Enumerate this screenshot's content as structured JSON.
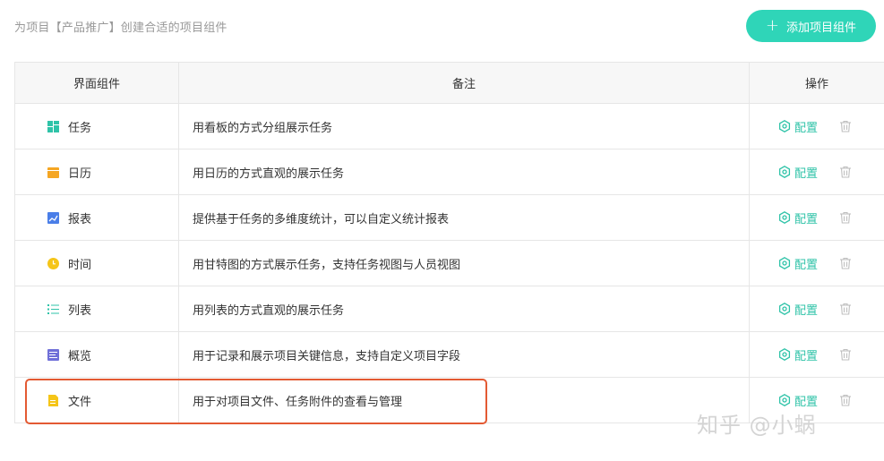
{
  "header": {
    "subtitle": "为项目【产品推广】创建合适的项目组件",
    "add_button_label": "添加项目组件",
    "accent_color": "#2fd5b8"
  },
  "table": {
    "columns": [
      "界面组件",
      "备注",
      "操作"
    ],
    "config_label": "配置",
    "rows": [
      {
        "name": "任务",
        "icon": "kanban-icon",
        "icon_color": "#2fc3a8",
        "note": "用看板的方式分组展示任务"
      },
      {
        "name": "日历",
        "icon": "calendar-icon",
        "icon_color": "#f5a623",
        "note": "用日历的方式直观的展示任务"
      },
      {
        "name": "报表",
        "icon": "chart-icon",
        "icon_color": "#4a7ee8",
        "note": "提供基于任务的多维度统计，可以自定义统计报表"
      },
      {
        "name": "时间",
        "icon": "clock-icon",
        "icon_color": "#f5c518",
        "note": "用甘特图的方式展示任务，支持任务视图与人员视图"
      },
      {
        "name": "列表",
        "icon": "list-icon",
        "icon_color": "#2fc3a8",
        "note": "用列表的方式直观的展示任务"
      },
      {
        "name": "概览",
        "icon": "overview-icon",
        "icon_color": "#6f6fd8",
        "note": "用于记录和展示项目关键信息，支持自定义项目字段"
      },
      {
        "name": "文件",
        "icon": "file-icon",
        "icon_color": "#f5c518",
        "note": "用于对项目文件、任务附件的查看与管理"
      }
    ]
  },
  "highlight_color": "#e35a33",
  "watermark": "知乎 @小蜗"
}
